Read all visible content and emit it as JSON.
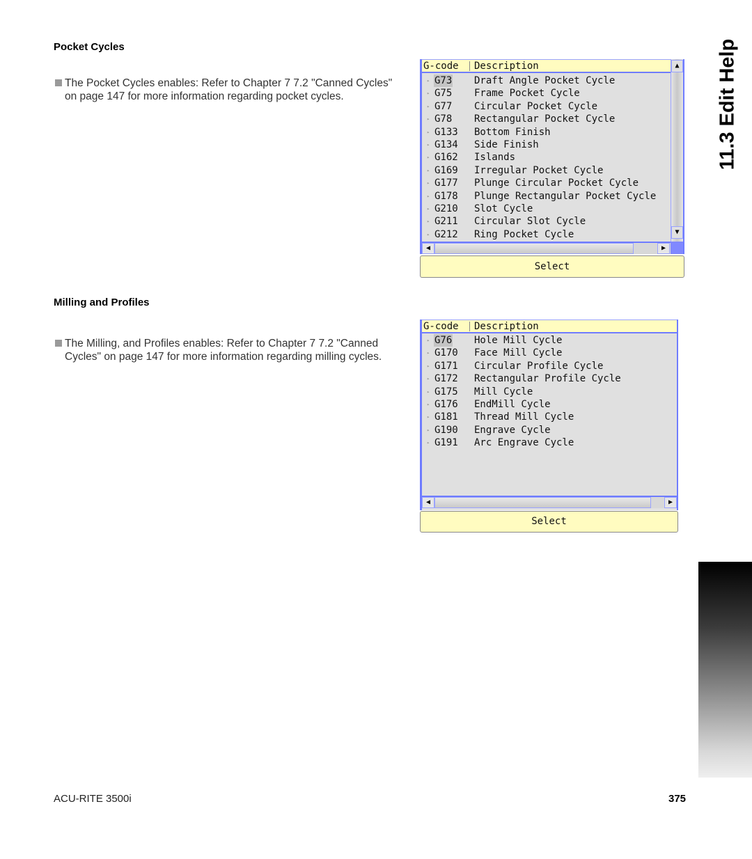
{
  "side_tab": {
    "title": "11.3 Edit Help"
  },
  "sections": [
    {
      "heading": "Pocket Cycles",
      "body": "The Pocket Cycles enables: Refer to Chapter 7 7.2 \"Canned Cycles\" on page 147 for more information regarding pocket cycles.",
      "dialog": {
        "header": {
          "gcode": "G-code",
          "description": "Description"
        },
        "rows": [
          {
            "code": "G73",
            "desc": "Draft Angle Pocket Cycle",
            "selected": true
          },
          {
            "code": "G75",
            "desc": "Frame Pocket Cycle"
          },
          {
            "code": "G77",
            "desc": "Circular Pocket Cycle"
          },
          {
            "code": "G78",
            "desc": "Rectangular Pocket Cycle"
          },
          {
            "code": "G133",
            "desc": "Bottom Finish"
          },
          {
            "code": "G134",
            "desc": "Side Finish"
          },
          {
            "code": "G162",
            "desc": "Islands"
          },
          {
            "code": "G169",
            "desc": "Irregular Pocket Cycle"
          },
          {
            "code": "G177",
            "desc": "Plunge Circular Pocket Cycle"
          },
          {
            "code": "G178",
            "desc": "Plunge Rectangular Pocket Cycle"
          },
          {
            "code": "G210",
            "desc": "Slot Cycle"
          },
          {
            "code": "G211",
            "desc": "Circular Slot Cycle"
          },
          {
            "code": "G212",
            "desc": "Ring Pocket Cycle"
          }
        ],
        "select_label": "Select"
      }
    },
    {
      "heading": "Milling and Profiles",
      "body": "The Milling, and Profiles enables: Refer to Chapter 7 7.2 \"Canned Cycles\" on page 147 for more information regarding milling cycles.",
      "dialog": {
        "header": {
          "gcode": "G-code",
          "description": "Description"
        },
        "rows": [
          {
            "code": "G76",
            "desc": "Hole Mill Cycle",
            "selected": true
          },
          {
            "code": "G170",
            "desc": "Face Mill Cycle"
          },
          {
            "code": "G171",
            "desc": "Circular Profile Cycle"
          },
          {
            "code": "G172",
            "desc": "Rectangular Profile Cycle"
          },
          {
            "code": "G175",
            "desc": "Mill Cycle"
          },
          {
            "code": "G176",
            "desc": "EndMill Cycle"
          },
          {
            "code": "G181",
            "desc": "Thread Mill Cycle"
          },
          {
            "code": "G190",
            "desc": "Engrave Cycle"
          },
          {
            "code": "G191",
            "desc": "Arc Engrave Cycle"
          }
        ],
        "select_label": "Select"
      }
    }
  ],
  "icons": {
    "row_arrow": "▸",
    "scroll_up": "▲",
    "scroll_down": "▼",
    "scroll_left": "◀",
    "scroll_right": "▶"
  },
  "footer": {
    "product": "ACU-RITE 3500i",
    "page_number": "375"
  }
}
